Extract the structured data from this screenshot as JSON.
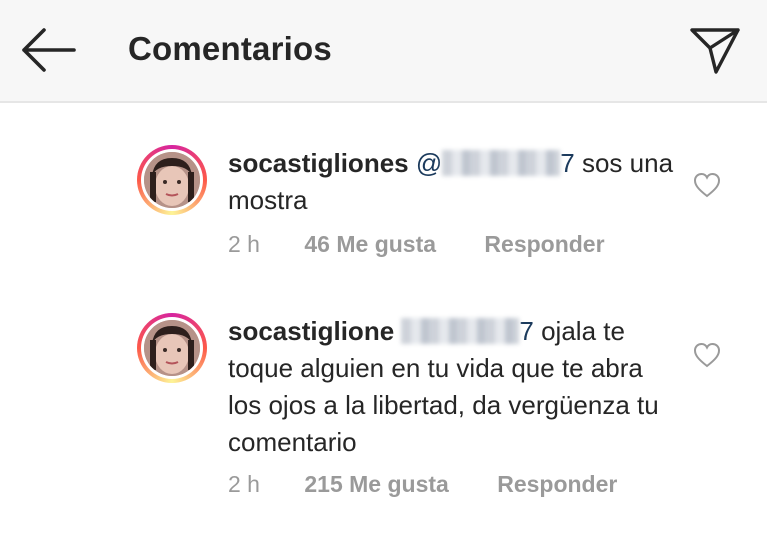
{
  "header": {
    "title": "Comentarios",
    "back_icon": "arrow-left-icon",
    "send_icon": "paper-plane-icon"
  },
  "comments": [
    {
      "username": "socastigliones",
      "mention_prefix": "@",
      "mention_suffix": "7",
      "text": "sos una mostra",
      "time": "2 h",
      "likes": "46 Me gusta",
      "reply": "Responder"
    },
    {
      "username": "socastiglione",
      "mention_prefix": "",
      "mention_suffix": "7",
      "text": "ojala te toque alguien en tu vida que te abra los ojos a la libertad, da vergüenza tu comentario",
      "time": "2 h",
      "likes": "215 Me gusta",
      "reply": "Responder"
    }
  ]
}
